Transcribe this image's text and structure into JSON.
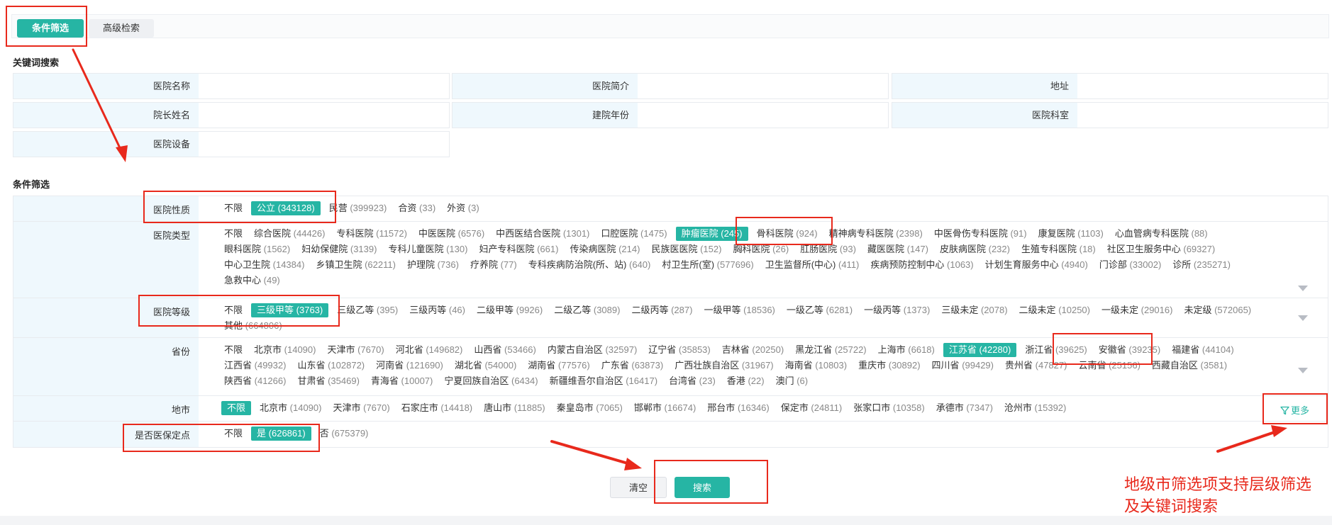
{
  "tabs": [
    {
      "label": "条件筛选",
      "active": true
    },
    {
      "label": "高级检索",
      "active": false
    }
  ],
  "keyword_section": {
    "title": "关键词搜索",
    "fields": [
      {
        "label": "医院名称",
        "value": ""
      },
      {
        "label": "医院简介",
        "value": ""
      },
      {
        "label": "地址",
        "value": ""
      },
      {
        "label": "院长姓名",
        "value": ""
      },
      {
        "label": "建院年份",
        "value": ""
      },
      {
        "label": "医院科室",
        "value": ""
      },
      {
        "label": "医院设备",
        "value": ""
      }
    ]
  },
  "filter_section": {
    "title": "条件筛选",
    "rows": [
      {
        "label": "医院性质",
        "options": [
          {
            "name": "不限",
            "count": ""
          },
          {
            "name": "公立",
            "count": "(343128)",
            "selected": true
          },
          {
            "name": "民营",
            "count": "(399923)"
          },
          {
            "name": "合资",
            "count": "(33)"
          },
          {
            "name": "外资",
            "count": "(3)"
          }
        ]
      },
      {
        "label": "医院类型",
        "expandable": true,
        "options": [
          {
            "name": "不限",
            "count": ""
          },
          {
            "name": "综合医院",
            "count": "(44426)"
          },
          {
            "name": "专科医院",
            "count": "(11572)"
          },
          {
            "name": "中医医院",
            "count": "(6576)"
          },
          {
            "name": "中西医结合医院",
            "count": "(1301)"
          },
          {
            "name": "口腔医院",
            "count": "(1475)"
          },
          {
            "name": "肿瘤医院",
            "count": "(245)",
            "selected": true
          },
          {
            "name": "骨科医院",
            "count": "(924)"
          },
          {
            "name": "精神病专科医院",
            "count": "(2398)"
          },
          {
            "name": "中医骨伤专科医院",
            "count": "(91)"
          },
          {
            "name": "康复医院",
            "count": "(1103)"
          },
          {
            "name": "心血管病专科医院",
            "count": "(88)"
          },
          {
            "name": "眼科医院",
            "count": "(1562)"
          },
          {
            "name": "妇幼保健院",
            "count": "(3139)"
          },
          {
            "name": "专科儿童医院",
            "count": "(130)"
          },
          {
            "name": "妇产专科医院",
            "count": "(661)"
          },
          {
            "name": "传染病医院",
            "count": "(214)"
          },
          {
            "name": "民族医医院",
            "count": "(152)"
          },
          {
            "name": "胸科医院",
            "count": "(26)"
          },
          {
            "name": "肛肠医院",
            "count": "(93)"
          },
          {
            "name": "藏医医院",
            "count": "(147)"
          },
          {
            "name": "皮肤病医院",
            "count": "(232)"
          },
          {
            "name": "生殖专科医院",
            "count": "(18)"
          },
          {
            "name": "社区卫生服务中心",
            "count": "(69327)"
          },
          {
            "name": "中心卫生院",
            "count": "(14384)"
          },
          {
            "name": "乡镇卫生院",
            "count": "(62211)"
          },
          {
            "name": "护理院",
            "count": "(736)"
          },
          {
            "name": "疗养院",
            "count": "(77)"
          },
          {
            "name": "专科疾病防治院(所、站)",
            "count": "(640)"
          },
          {
            "name": "村卫生所(室)",
            "count": "(577696)"
          },
          {
            "name": "卫生监督所(中心)",
            "count": "(411)"
          },
          {
            "name": "疾病预防控制中心",
            "count": "(1063)"
          },
          {
            "name": "计划生育服务中心",
            "count": "(4940)"
          },
          {
            "name": "门诊部",
            "count": "(33002)"
          },
          {
            "name": "诊所",
            "count": "(235271)"
          },
          {
            "name": "急救中心",
            "count": "(49)"
          }
        ]
      },
      {
        "label": "医院等级",
        "expandable": true,
        "options": [
          {
            "name": "不限",
            "count": ""
          },
          {
            "name": "三级甲等",
            "count": "(3763)",
            "selected": true
          },
          {
            "name": "三级乙等",
            "count": "(395)"
          },
          {
            "name": "三级丙等",
            "count": "(46)"
          },
          {
            "name": "二级甲等",
            "count": "(9926)"
          },
          {
            "name": "二级乙等",
            "count": "(3089)"
          },
          {
            "name": "二级丙等",
            "count": "(287)"
          },
          {
            "name": "一级甲等",
            "count": "(18536)"
          },
          {
            "name": "一级乙等",
            "count": "(6281)"
          },
          {
            "name": "一级丙等",
            "count": "(1373)"
          },
          {
            "name": "三级未定",
            "count": "(2078)"
          },
          {
            "name": "二级未定",
            "count": "(10250)"
          },
          {
            "name": "一级未定",
            "count": "(29016)"
          },
          {
            "name": "未定级",
            "count": "(572065)"
          },
          {
            "name": "其他",
            "count": "(664806)"
          }
        ]
      },
      {
        "label": "省份",
        "expandable": true,
        "options": [
          {
            "name": "不限",
            "count": ""
          },
          {
            "name": "北京市",
            "count": "(14090)"
          },
          {
            "name": "天津市",
            "count": "(7670)"
          },
          {
            "name": "河北省",
            "count": "(149682)"
          },
          {
            "name": "山西省",
            "count": "(53466)"
          },
          {
            "name": "内蒙古自治区",
            "count": "(32597)"
          },
          {
            "name": "辽宁省",
            "count": "(35853)"
          },
          {
            "name": "吉林省",
            "count": "(20250)"
          },
          {
            "name": "黑龙江省",
            "count": "(25722)"
          },
          {
            "name": "上海市",
            "count": "(6618)"
          },
          {
            "name": "江苏省",
            "count": "(42280)",
            "selected": true
          },
          {
            "name": "浙江省",
            "count": "(39625)"
          },
          {
            "name": "安徽省",
            "count": "(39235)"
          },
          {
            "name": "福建省",
            "count": "(44104)"
          },
          {
            "name": "江西省",
            "count": "(49932)"
          },
          {
            "name": "山东省",
            "count": "(102872)"
          },
          {
            "name": "河南省",
            "count": "(121690)"
          },
          {
            "name": "湖北省",
            "count": "(54000)"
          },
          {
            "name": "湖南省",
            "count": "(77576)"
          },
          {
            "name": "广东省",
            "count": "(63873)"
          },
          {
            "name": "广西壮族自治区",
            "count": "(31967)"
          },
          {
            "name": "海南省",
            "count": "(10803)"
          },
          {
            "name": "重庆市",
            "count": "(30892)"
          },
          {
            "name": "四川省",
            "count": "(99429)"
          },
          {
            "name": "贵州省",
            "count": "(47827)"
          },
          {
            "name": "云南省",
            "count": "(25156)"
          },
          {
            "name": "西藏自治区",
            "count": "(3581)"
          },
          {
            "name": "陕西省",
            "count": "(41266)"
          },
          {
            "name": "甘肃省",
            "count": "(35469)"
          },
          {
            "name": "青海省",
            "count": "(10007)"
          },
          {
            "name": "宁夏回族自治区",
            "count": "(6434)"
          },
          {
            "name": "新疆维吾尔自治区",
            "count": "(16417)"
          },
          {
            "name": "台湾省",
            "count": "(23)"
          },
          {
            "name": "香港",
            "count": "(22)"
          },
          {
            "name": "澳门",
            "count": "(6)"
          }
        ]
      },
      {
        "label": "地市",
        "more_label": "更多",
        "options": [
          {
            "name": "不限",
            "count": "",
            "selected": true
          },
          {
            "name": "北京市",
            "count": "(14090)"
          },
          {
            "name": "天津市",
            "count": "(7670)"
          },
          {
            "name": "石家庄市",
            "count": "(14418)"
          },
          {
            "name": "唐山市",
            "count": "(11885)"
          },
          {
            "name": "秦皇岛市",
            "count": "(7065)"
          },
          {
            "name": "邯郸市",
            "count": "(16674)"
          },
          {
            "name": "邢台市",
            "count": "(16346)"
          },
          {
            "name": "保定市",
            "count": "(24811)"
          },
          {
            "name": "张家口市",
            "count": "(10358)"
          },
          {
            "name": "承德市",
            "count": "(7347)"
          },
          {
            "name": "沧州市",
            "count": "(15392)"
          }
        ]
      },
      {
        "label": "是否医保定点",
        "options": [
          {
            "name": "不限",
            "count": ""
          },
          {
            "name": "是",
            "count": "(626861)",
            "selected": true
          },
          {
            "name": "否",
            "count": "(675379)"
          }
        ]
      }
    ]
  },
  "buttons": {
    "clear": "清空",
    "search": "搜索"
  },
  "annotation_note": [
    "地级市筛选项支持层级筛选",
    "及关键词搜索"
  ],
  "colors": {
    "accent": "#26b5a4",
    "label_bg": "#eff8fd",
    "annotation": "#e8291c"
  },
  "icons": {
    "expand": "chevron-down-icon",
    "more": "filter-icon"
  }
}
